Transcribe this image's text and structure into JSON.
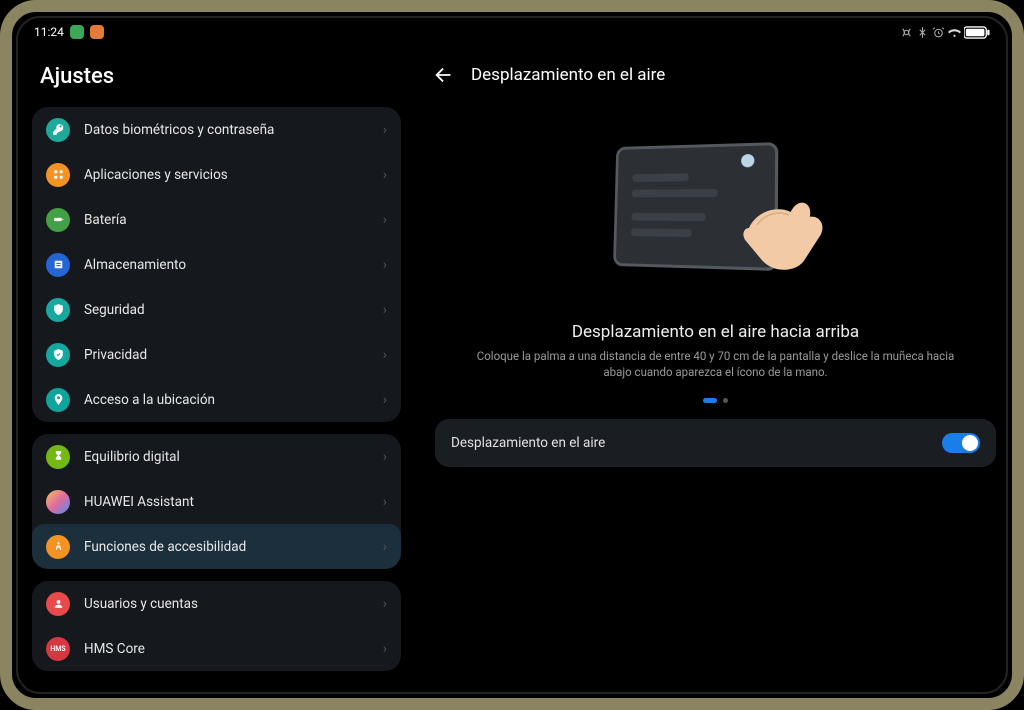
{
  "status": {
    "time": "11:24"
  },
  "sidebar": {
    "title": "Ajustes",
    "groups": [
      [
        {
          "label": "Datos biométricos y contraseña"
        },
        {
          "label": "Aplicaciones y servicios"
        },
        {
          "label": "Batería"
        },
        {
          "label": "Almacenamiento"
        },
        {
          "label": "Seguridad"
        },
        {
          "label": "Privacidad"
        },
        {
          "label": "Acceso a la ubicación"
        }
      ],
      [
        {
          "label": "Equilibrio digital"
        },
        {
          "label": "HUAWEI Assistant"
        },
        {
          "label": "Funciones de accesibilidad"
        }
      ],
      [
        {
          "label": "Usuarios y cuentas"
        },
        {
          "label": "HMS Core"
        }
      ]
    ]
  },
  "detail": {
    "title": "Desplazamiento en el aire",
    "instruction_title": "Desplazamiento en el aire hacia arriba",
    "instruction_desc": "Coloque la palma a una distancia de entre 40 y 70 cm de la pantalla y deslice la muñeca hacia abajo cuando aparezca el ícono de la mano.",
    "toggle_label": "Desplazamiento en el aire",
    "toggle_on": true
  }
}
